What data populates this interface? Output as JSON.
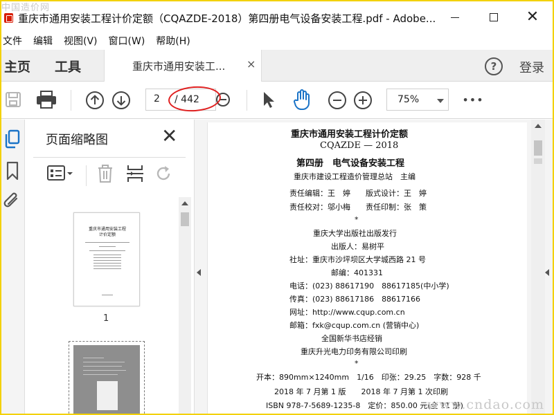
{
  "watermark": {
    "top_left": "中国造价网",
    "bottom_right": "www.cndao.com"
  },
  "window": {
    "title": "重庆市通用安装工程计价定额（CQAZDE-2018）第四册电气设备安装工程.pdf - Adobe...",
    "minimize": "minimize",
    "maximize": "maximize",
    "close": "✕"
  },
  "menu": [
    "文件",
    "编辑",
    "视图(V)",
    "窗口(W)",
    "帮助(H)"
  ],
  "tabs": {
    "home": "主页",
    "tools": "工具",
    "document": "重庆市通用安装工...",
    "document_close": "×",
    "help": "?",
    "login": "登录"
  },
  "toolbar": {
    "current_page": "2",
    "total_pages": "/ 442",
    "zoom": "75%",
    "more": "•••"
  },
  "thumbnails_panel": {
    "title": "页面缩略图",
    "close": "✕",
    "thumb1_title": "重庆市通用安装工程\n计价定额",
    "thumb1_label": "1"
  },
  "colors": {
    "annotation_oval": "#e02020",
    "border": "#f3d100"
  },
  "page_content": {
    "title": "重庆市通用安装工程计价定额",
    "code": "CQAZDE — 2018",
    "volume": "第四册　电气设备安装工程",
    "compiler": "重庆市建设工程造价管理总站　主编",
    "editor": "责任编辑：王　婷　　版式设计：王　婷",
    "proofreader": "责任校对：邬小梅　　责任印制：张　策",
    "star1": "*",
    "publisher": "重庆大学出版社出版发行",
    "issuer": "出版人：易树平",
    "address": "社址：重庆市沙坪坝区大学城西路 21 号",
    "postcode": "邮编：401331",
    "phone": "电话：(023) 88617190　88617185(中小学)",
    "fax": "传真：(023) 88617186　88617166",
    "website": "网址：http://www.cqup.com.cn",
    "email": "邮箱：fxk@cqup.com.cn (营销中心)",
    "seller": "全国新华书店经销",
    "printer": "重庆升光电力印务有限公司印刷",
    "star2": "*",
    "format": "开本：890mm×1240mm　1/16　印张：29.25　字数：928 千",
    "edition": "2018 年 7 月第 1 版　　2018 年 7 月第 1 次印刷",
    "isbn": "ISBN 978-7-5689-1235-8　定价：850.00 元(全 11 册)"
  }
}
